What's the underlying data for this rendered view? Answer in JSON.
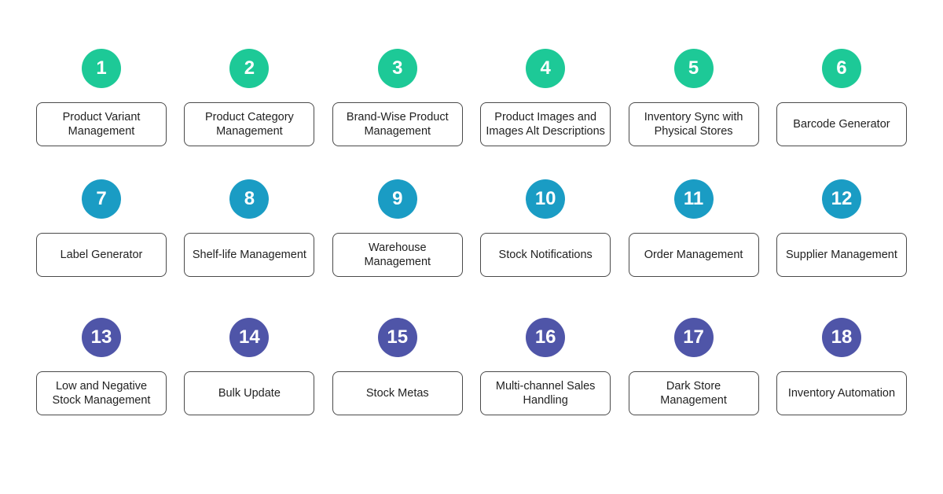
{
  "colors": {
    "row1": "#1dc997",
    "row2": "#1a9cc4",
    "row3": "#4f55a8"
  },
  "items": [
    {
      "num": "1",
      "label": "Product Variant Management"
    },
    {
      "num": "2",
      "label": "Product Category Management"
    },
    {
      "num": "3",
      "label": "Brand-Wise Product Management"
    },
    {
      "num": "4",
      "label": "Product Images and Images Alt Descriptions"
    },
    {
      "num": "5",
      "label": "Inventory Sync with Physical Stores"
    },
    {
      "num": "6",
      "label": "Barcode Generator"
    },
    {
      "num": "7",
      "label": "Label Generator"
    },
    {
      "num": "8",
      "label": "Shelf-life Management"
    },
    {
      "num": "9",
      "label": "Warehouse Management"
    },
    {
      "num": "10",
      "label": "Stock Notifications"
    },
    {
      "num": "11",
      "label": "Order Management"
    },
    {
      "num": "12",
      "label": "Supplier Management"
    },
    {
      "num": "13",
      "label": "Low and Negative Stock Management"
    },
    {
      "num": "14",
      "label": "Bulk Update"
    },
    {
      "num": "15",
      "label": "Stock Metas"
    },
    {
      "num": "16",
      "label": "Multi-channel Sales Handling"
    },
    {
      "num": "17",
      "label": "Dark Store Management"
    },
    {
      "num": "18",
      "label": "Inventory Automation"
    }
  ]
}
